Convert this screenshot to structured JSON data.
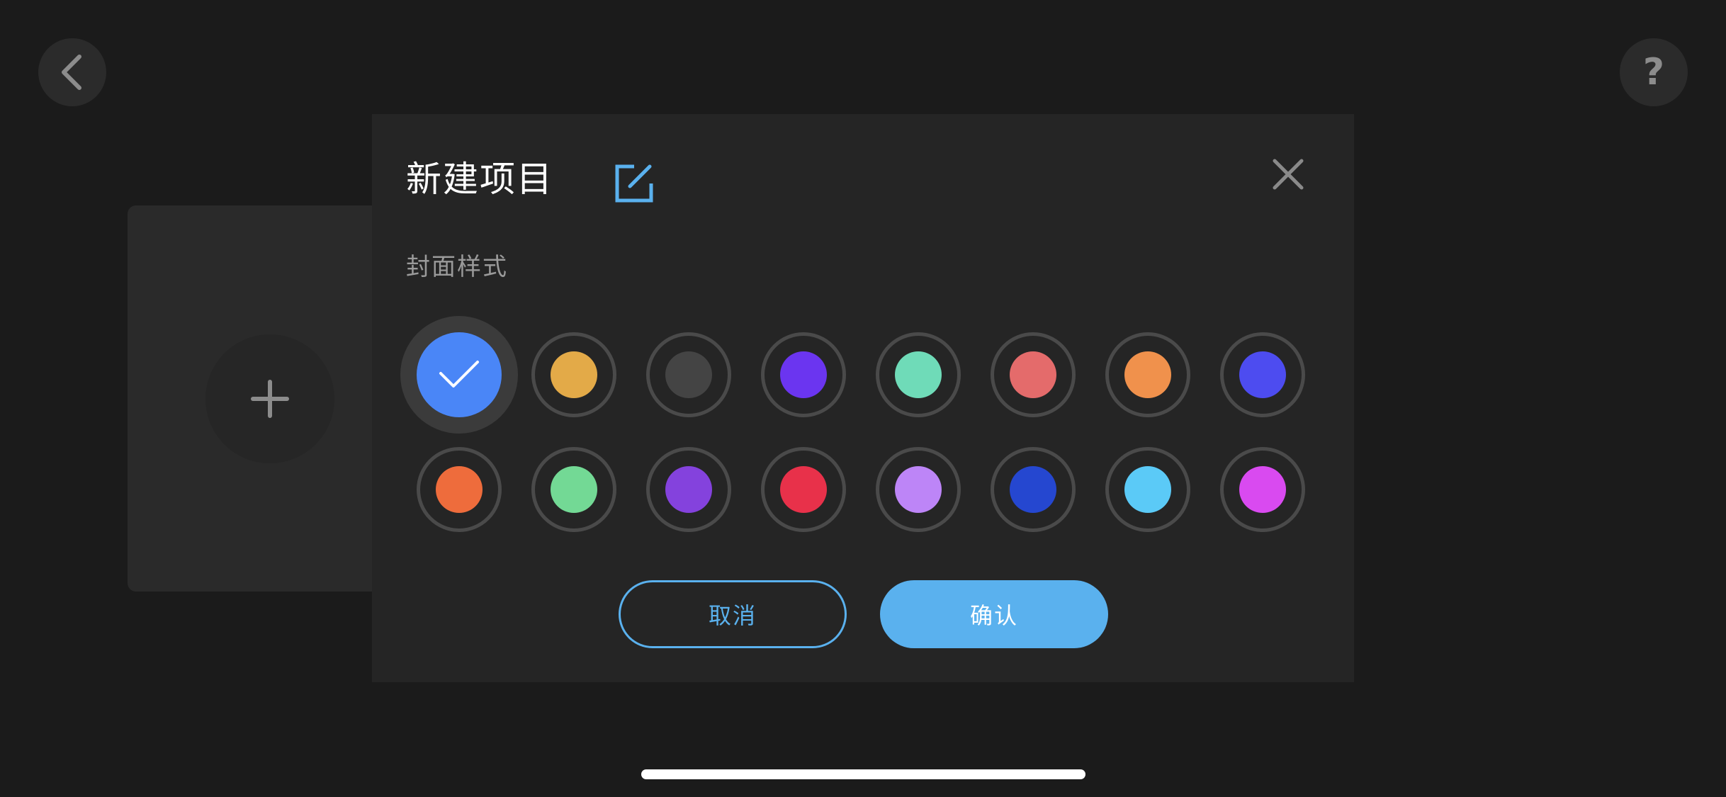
{
  "nav": {
    "back_icon": "chevron-left-icon",
    "help_label": "?"
  },
  "background": {
    "add_icon": "plus-icon"
  },
  "modal": {
    "title": "新建项目",
    "edit_icon": "edit-icon",
    "close_icon": "close-icon",
    "section_label": "封面样式",
    "selected_index": 0,
    "swatches": [
      {
        "color": "#4a86f7"
      },
      {
        "color": "#e3aa48"
      },
      {
        "color": "#444444"
      },
      {
        "color": "#6b35f0"
      },
      {
        "color": "#6fdbb8"
      },
      {
        "color": "#e46b6b"
      },
      {
        "color": "#f0914c"
      },
      {
        "color": "#4d4cf0"
      },
      {
        "color": "#ee6c3c"
      },
      {
        "color": "#73d995"
      },
      {
        "color": "#8442dd"
      },
      {
        "color": "#e8314a"
      },
      {
        "color": "#bd85f7"
      },
      {
        "color": "#2547d0"
      },
      {
        "color": "#5bcaf7"
      },
      {
        "color": "#d94af0"
      }
    ],
    "cancel_label": "取消",
    "confirm_label": "确认"
  },
  "colors": {
    "accent": "#5ab1ee",
    "modal_bg": "#252525",
    "screen_bg": "#1b1b1b"
  }
}
